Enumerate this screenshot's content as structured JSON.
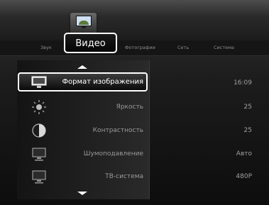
{
  "menu": {
    "tabs": [
      "Звук",
      "Видео",
      "Фотографии",
      "Сеть",
      "Система"
    ],
    "active_tab": "Видео"
  },
  "settings": [
    {
      "label": "Формат изображения",
      "value": "16:09",
      "icon": "picture-format-icon",
      "selected": true
    },
    {
      "label": "Яркость",
      "value": "25",
      "icon": "brightness-icon",
      "selected": false
    },
    {
      "label": "Контрастность",
      "value": "25",
      "icon": "contrast-icon",
      "selected": false
    },
    {
      "label": "Шумоподавление",
      "value": "Авто",
      "icon": "noise-reduction-icon",
      "selected": false
    },
    {
      "label": "ТВ-система",
      "value": "480P",
      "icon": "tv-system-icon",
      "selected": false
    }
  ],
  "colors": {
    "accent": "#ffffff",
    "background": "#1b1b1b",
    "inactive_text": "#9a9a9a"
  }
}
